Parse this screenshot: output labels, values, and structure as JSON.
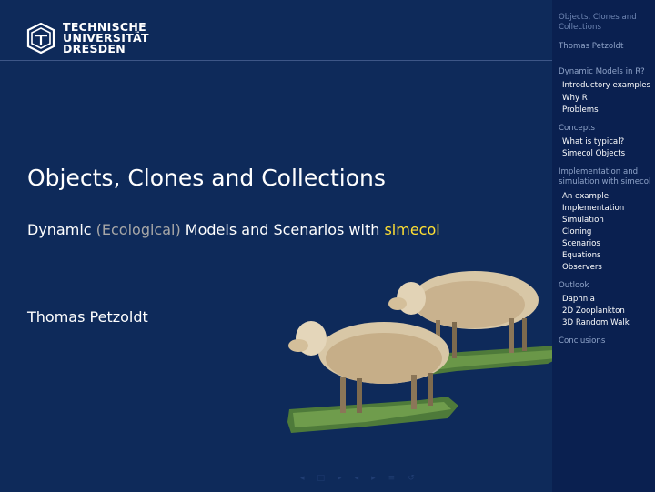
{
  "logo": {
    "line1": "TECHNISCHE",
    "line2": "UNIVERSITÄT",
    "line3": "DRESDEN"
  },
  "title": "Objects, Clones and Collections",
  "subtitle": {
    "part1": "Dynamic ",
    "part2": "(Ecological)",
    "part3": " Models and Scenarios with ",
    "part4": "simecol"
  },
  "author": "Thomas Petzoldt",
  "sidebar": {
    "short_title_1": "Objects, Clones and",
    "short_title_2": "Collections",
    "author": "Thomas Petzoldt",
    "sections": [
      {
        "title": "Dynamic Models in R?",
        "items": [
          "Introductory examples",
          "Why R",
          "Problems"
        ]
      },
      {
        "title": "Concepts",
        "items": [
          "What is typical?",
          "Simecol Objects"
        ]
      },
      {
        "title_1": "Implementation and",
        "title_2": "simulation with simecol",
        "items": [
          "An example",
          "Implementation",
          "Simulation",
          "Cloning",
          "Scenarios",
          "Equations",
          "Observers"
        ]
      },
      {
        "title": "Outlook",
        "items": [
          "Daphnia",
          "2D Zooplankton",
          "3D Random Walk"
        ]
      },
      {
        "title": "Conclusions",
        "items": []
      }
    ]
  },
  "colors": {
    "background": "#0e2a5a",
    "sidebar": "#0a2050",
    "highlight_gray": "#a7a7a7",
    "highlight_yellow": "#ffe033"
  }
}
